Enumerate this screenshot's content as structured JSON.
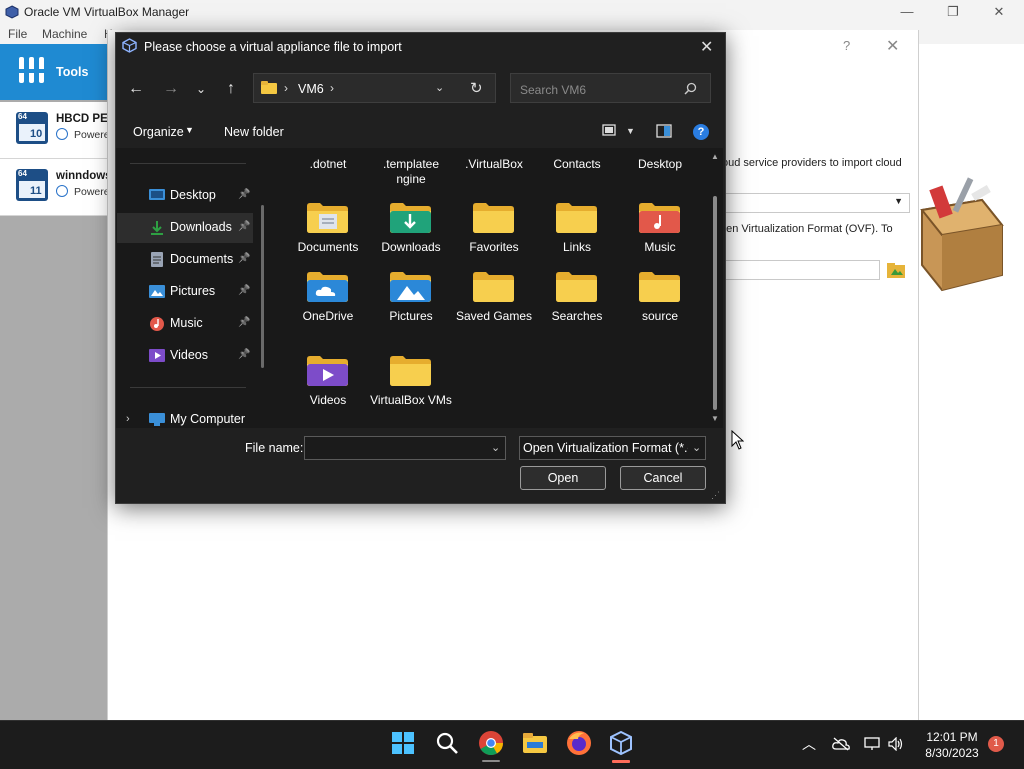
{
  "window": {
    "title": "Oracle VM VirtualBox Manager",
    "controls": [
      "—",
      "❐",
      "✕"
    ]
  },
  "menubar": [
    "File",
    "Machine",
    "H"
  ],
  "sidebar": {
    "tools_label": "Tools",
    "vms": [
      {
        "name": "HBCD PE x",
        "state": "Powere",
        "badge_top": "64",
        "badge_num": "10"
      },
      {
        "name": "winndows",
        "state": "Powere",
        "badge_top": "64",
        "badge_num": "11"
      }
    ]
  },
  "wizard": {
    "help": "?",
    "close": "✕",
    "text1": "oud service providers to import cloud",
    "text2": "pen Virtualization Format (OVF). To"
  },
  "dialog": {
    "title": "Please choose a virtual appliance file to import",
    "close": "✕",
    "address": {
      "sep1": "›",
      "folder": "VM6",
      "sep2": "›"
    },
    "search_placeholder": "Search VM6",
    "organize": "Organize",
    "new_folder": "New folder",
    "nav": [
      {
        "label": "Desktop",
        "icon": "desktop-icon",
        "color": "#3a8fd8",
        "pinned": true
      },
      {
        "label": "Downloads",
        "icon": "downloads-icon",
        "color": "#2ea043",
        "pinned": true,
        "selected": true
      },
      {
        "label": "Documents",
        "icon": "documents-icon",
        "color": "#9aa4b5",
        "pinned": true
      },
      {
        "label": "Pictures",
        "icon": "pictures-icon",
        "color": "#3a8fd8",
        "pinned": true
      },
      {
        "label": "Music",
        "icon": "music-icon",
        "color": "#e2584a",
        "pinned": true
      },
      {
        "label": "Videos",
        "icon": "videos-icon",
        "color": "#7d4cc9",
        "pinned": true
      }
    ],
    "nav_computer": "My Computer",
    "partial_top_row": [
      ".dotnet",
      ".templatee ngine",
      ".VirtualBox",
      "Contacts",
      "Desktop"
    ],
    "files": [
      {
        "label": "Documents",
        "icon": "documents-folder-icon"
      },
      {
        "label": "Downloads",
        "icon": "downloads-folder-icon"
      },
      {
        "label": "Favorites",
        "icon": "folder-icon"
      },
      {
        "label": "Links",
        "icon": "folder-icon"
      },
      {
        "label": "Music",
        "icon": "music-folder-icon"
      },
      {
        "label": "OneDrive",
        "icon": "onedrive-folder-icon"
      },
      {
        "label": "Pictures",
        "icon": "pictures-folder-icon"
      },
      {
        "label": "Saved Games",
        "icon": "folder-icon"
      },
      {
        "label": "Searches",
        "icon": "folder-icon"
      },
      {
        "label": "source",
        "icon": "folder-icon"
      },
      {
        "label": "Videos",
        "icon": "videos-folder-icon"
      },
      {
        "label": "VirtualBox VMs",
        "icon": "folder-icon"
      }
    ],
    "file_name_label": "File name:",
    "file_name_value": "",
    "filter": "Open Virtualization Format (*.o",
    "open": "Open",
    "cancel": "Cancel"
  },
  "taskbar": {
    "time": "12:01 PM",
    "date": "8/30/2023",
    "notifications": "1",
    "apps": [
      "start-icon",
      "search-icon",
      "chrome-icon",
      "file-explorer-icon",
      "firefox-icon",
      "virtualbox-icon"
    ]
  },
  "colors": {
    "accent": "#1f8ad2",
    "folder": "#f5c842",
    "dialog_bg": "#202020"
  }
}
